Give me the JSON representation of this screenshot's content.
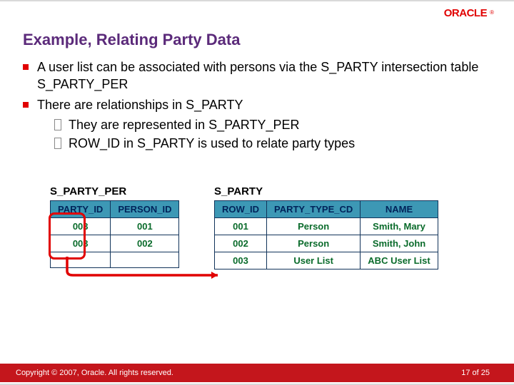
{
  "logo_text": "ORACLE",
  "title": "Example, Relating Party Data",
  "bullets": {
    "b0": "A user list can be associated with persons via the S_PARTY intersection table S_PARTY_PER",
    "b1": "There are relationships in S_PARTY",
    "b1a": "They are represented in S_PARTY_PER",
    "b1b": "ROW_ID in S_PARTY is used to relate party types"
  },
  "tables": {
    "left": {
      "label": "S_PARTY_PER",
      "headers": [
        "PARTY_ID",
        "PERSON_ID"
      ],
      "rows": [
        [
          "003",
          "001"
        ],
        [
          "003",
          "002"
        ],
        [
          "",
          ""
        ]
      ]
    },
    "right": {
      "label": "S_PARTY",
      "headers": [
        "ROW_ID",
        "PARTY_TYPE_CD",
        "NAME"
      ],
      "rows": [
        [
          "001",
          "Person",
          "Smith, Mary"
        ],
        [
          "002",
          "Person",
          "Smith, John"
        ],
        [
          "003",
          "User List",
          "ABC User List"
        ]
      ]
    }
  },
  "footer": {
    "copyright": "Copyright © 2007, Oracle. All rights reserved.",
    "page_text": "17 of 25"
  }
}
